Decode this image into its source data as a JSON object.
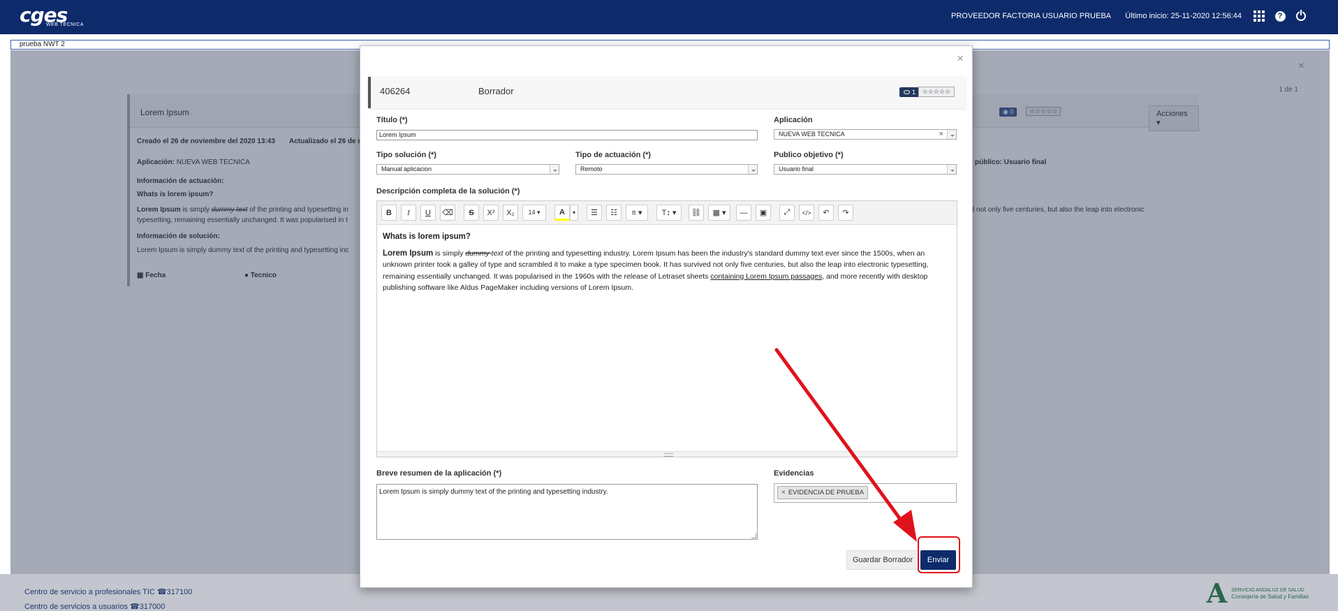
{
  "topbar": {
    "logo_text": "cges",
    "logo_subtext": "WEB TÉCNICA",
    "user": "PROVEEDOR FACTORIA USUARIO PRUEBA",
    "last_login": "Último inicio: 25-11-2020 12:56:44",
    "icons": [
      "apps-grid-icon",
      "help-icon",
      "power-icon"
    ]
  },
  "breadcrumb": "prueba NWT 2",
  "background": {
    "pager": "1 de 1",
    "title": "Lorem Ipsum",
    "badge_count": "0",
    "stars": "☆☆☆☆☆",
    "actions_label": "Acciones ▾",
    "created": "Creado el 26 de noviembre del 2020 13:43",
    "updated": "Actualizado el 26 de n",
    "app_label": "Aplicación:",
    "app_value": "NUEVA WEB TECNICA",
    "audience": "público: Usuario final",
    "info_actuacion": "Información de actuación:",
    "what_is": "Whats is lorem ipsum?",
    "body1_start": "Lorem Ipsum",
    "body1_mid": " is simply ",
    "body1_strike": "dummy text",
    "body1_rest": " of the printing and typesetting in",
    "body1_right": "survived not only five centuries, but also the leap into electronic",
    "body2": "typesetting, remaining essentially unchanged. It was popularised in t",
    "info_solucion": "Información de solución:",
    "body3": "Lorem Ipsum is simply dummy text of the printing and typesetting inc",
    "col_fecha": "Fecha",
    "col_tecnico": "Tecnico"
  },
  "footer": {
    "line1": "Centro de servicio a profesionales TIC ☎317100",
    "line2": "Centro de servicios a usuarios ☎317000",
    "logo_line1": "SERVICIO ANDALUZ DE SALUD",
    "logo_line2": "Consejería de Salud y Familias"
  },
  "modal": {
    "close": "×",
    "id": "406264",
    "status": "Borrador",
    "views": "1",
    "stars": "☆☆☆☆☆",
    "title_label": "Título (*)",
    "title_value": "Lorem Ipsum",
    "app_label": "Aplicación",
    "app_value": "NUEVA WEB TECNICA",
    "tipo_sol_label": "Tipo solución (*)",
    "tipo_sol_value": "Manual aplicacion",
    "tipo_act_label": "Tipo de actuación (*)",
    "tipo_act_value": "Remoto",
    "publico_label": "Publico objetivo (*)",
    "publico_value": "Usuario final",
    "desc_label": "Descripción completa de la solución (*)",
    "toolbar": {
      "bold": "B",
      "italic": "I",
      "underline": "U",
      "eraser": "⌫",
      "strike": "S",
      "superscript": "X²",
      "subscript": "X₂",
      "font_size": "14 ▾",
      "color": "A",
      "color_caret": "▾",
      "ul": "☰",
      "ol": "☷",
      "align": "≡ ▾",
      "line_height": "T↕ ▾",
      "link": "⛓",
      "table": "▦ ▾",
      "hr": "—",
      "image": "▣",
      "fullscreen": "⤢",
      "code": "</>",
      "undo": "↶",
      "redo": "↷"
    },
    "editor": {
      "heading": "Whats is lorem ipsum?",
      "p_bold": "Lorem Ipsum",
      "p_1": " is simply ",
      "p_strike": "dummy ",
      "p_ital": "text",
      "p_2": " of the printing and typesetting industry. Lorem Ipsum has been the industry's standard dummy text ever since the 1500s, when an unknown printer took a galley of type and scrambled it to make a type specimen book. It has survived not only five centuries, but also the leap into electronic typesetting, remaining essentially unchanged. It was popularised in the 1960s with the release of Letraset sheets ",
      "p_link": "containing Lorem Ipsum passages",
      "p_3": ", and more recently with desktop publishing software like Aldus PageMaker including versions of Lorem Ipsum."
    },
    "summary_label": "Breve resumen de la aplicación (*)",
    "summary_value": "Lorem Ipsum is simply dummy text of the printing and typesetting industry.",
    "evidence_label": "Evidencias",
    "evidence_tag": "EVIDENCIA DE PRUEBA",
    "save_draft": "Guardar Borrador",
    "send": "Enviar",
    "highlight_color": "#e0121b"
  }
}
